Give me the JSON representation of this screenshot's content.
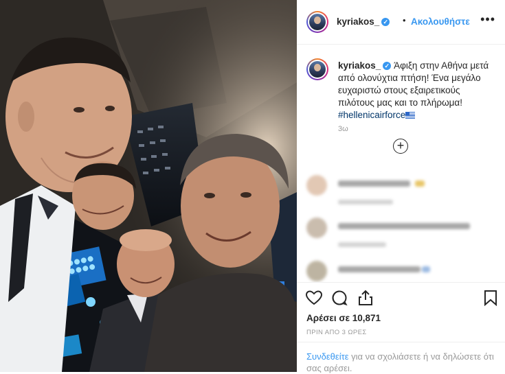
{
  "post": {
    "username": "kyriakos_",
    "verified_mark": "✓",
    "separator": "•",
    "follow_label": "Ακολουθήστε",
    "more_icon": "more-options-icon",
    "caption": {
      "username": "kyriakos_",
      "text": "Άφιξη στην Αθήνα μετά από ολονύχτια πτήση! Ένα μεγάλο ευχαριστώ στους εξαιρετικούς πιλότους μας και το πλήρωμα!",
      "hashtag": "#hellenicairforce",
      "age": "3ω"
    },
    "load_more_icon": "plus-circle-icon",
    "likes_text": "Αρέσει σε 10,871",
    "timestamp": "ΠΡΙΝ ΑΠΟ 3 ΩΡΕΣ",
    "login_prompt": {
      "link": "Συνδεθείτε",
      "rest": " για να σχολιάσετε ή να δηλώσετε ότι σας αρέσει."
    }
  },
  "colors": {
    "link_blue": "#3897f0",
    "hashtag_blue": "#003569",
    "text": "#262626",
    "muted": "#999999",
    "border": "#efefef"
  }
}
